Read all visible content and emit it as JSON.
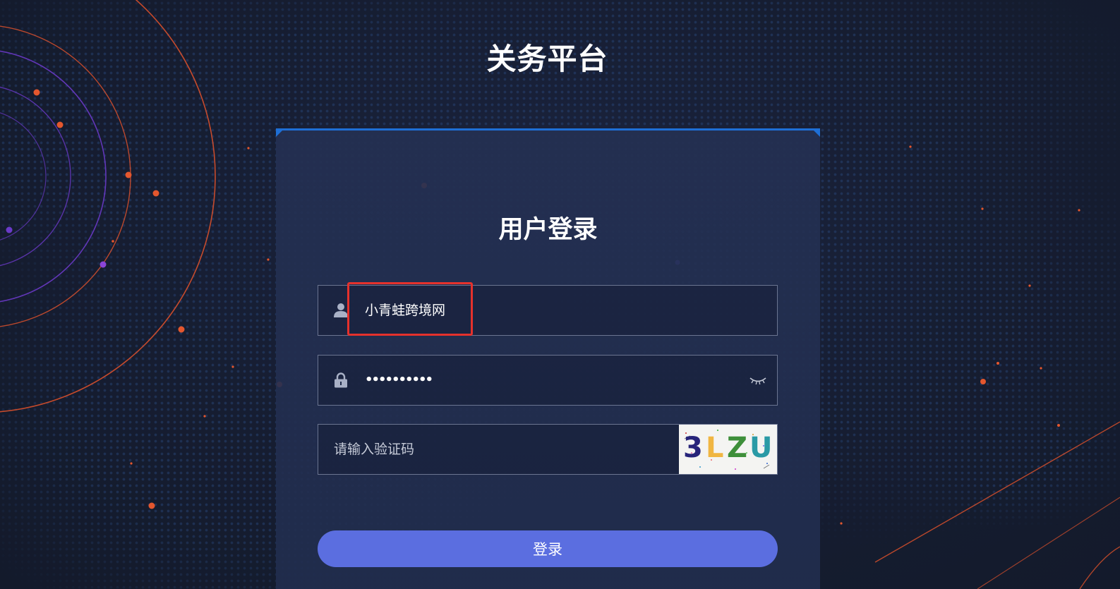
{
  "header": {
    "title": "关务平台"
  },
  "login": {
    "heading": "用户登录",
    "username": {
      "value": "小青蛙跨境网",
      "icon": "user-icon"
    },
    "password": {
      "value": "••••••••••",
      "icon": "lock-icon",
      "toggle_icon": "eye-closed-icon"
    },
    "captcha": {
      "placeholder": "请输入验证码",
      "code_chars": [
        "3",
        "L",
        "Z",
        "U"
      ]
    },
    "submit_label": "登录"
  },
  "colors": {
    "accent": "#5b6ee0",
    "panel_top_border": "#1e6fd6",
    "highlight": "#e5312c",
    "orbit_orange": "#e4572e",
    "orbit_purple": "#7b3fd0"
  }
}
